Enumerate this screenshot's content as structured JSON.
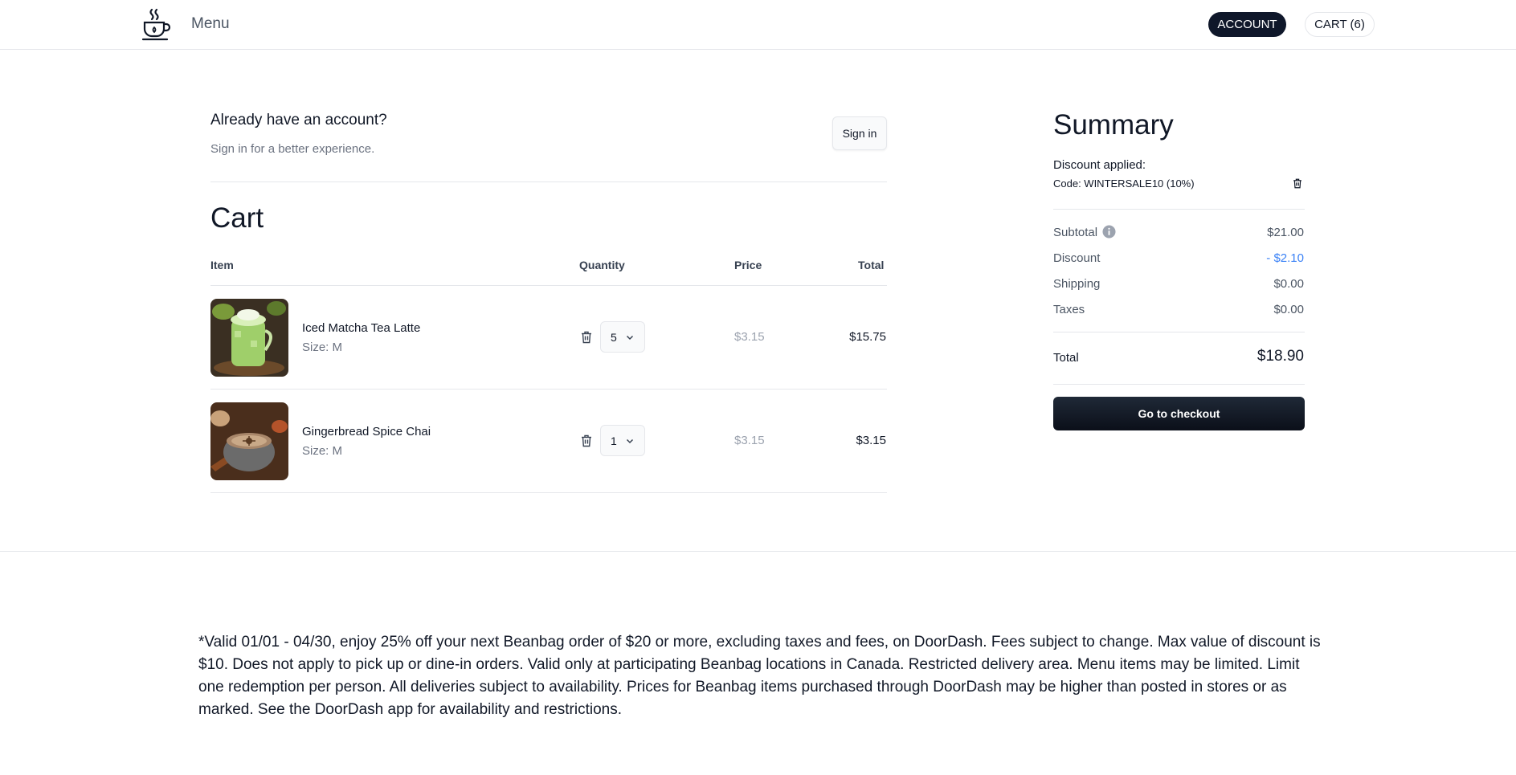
{
  "header": {
    "logo_icon": "coffee-cup-icon",
    "menu_label": "Menu",
    "account_label": "ACCOUNT",
    "cart_label": "CART (6)"
  },
  "account_prompt": {
    "heading": "Already have an account?",
    "subtext": "Sign in for a better experience.",
    "signin_label": "Sign in"
  },
  "cart": {
    "title": "Cart",
    "columns": {
      "item": "Item",
      "quantity": "Quantity",
      "price": "Price",
      "total": "Total"
    },
    "items": [
      {
        "name": "Iced Matcha Tea Latte",
        "size": "Size: M",
        "quantity": "5",
        "price": "$3.15",
        "total": "$15.75"
      },
      {
        "name": "Gingerbread Spice Chai",
        "size": "Size: M",
        "quantity": "1",
        "price": "$3.15",
        "total": "$3.15"
      }
    ]
  },
  "summary": {
    "title": "Summary",
    "discount_label": "Discount applied:",
    "discount_code": "Code: WINTERSALE10 (10%)",
    "rows": [
      {
        "label": "Subtotal",
        "value": "$21.00"
      },
      {
        "label": "Discount",
        "value": "- $2.10"
      },
      {
        "label": "Shipping",
        "value": "$0.00"
      },
      {
        "label": "Taxes",
        "value": "$0.00"
      }
    ],
    "total_label": "Total",
    "total_value": "$18.90",
    "checkout_label": "Go to checkout"
  },
  "footer": {
    "disclaimer": "*Valid 01/01 - 04/30, enjoy 25% off your next Beanbag order of $20 or more, excluding taxes and fees, on DoorDash. Fees subject to change. Max value of discount is $10. Does not apply to pick up or dine-in orders. Valid only at participating Beanbag locations in Canada. Restricted delivery area. Menu items may be limited. Limit one redemption per person. All deliveries subject to availability. Prices for Beanbag items purchased through DoorDash may be higher than posted in stores or as marked. See the DoorDash app for availability and restrictions."
  },
  "colors": {
    "primary": "#0f172a",
    "discount": "#3b82f6",
    "border": "#e5e7eb",
    "muted": "#6b7280"
  }
}
